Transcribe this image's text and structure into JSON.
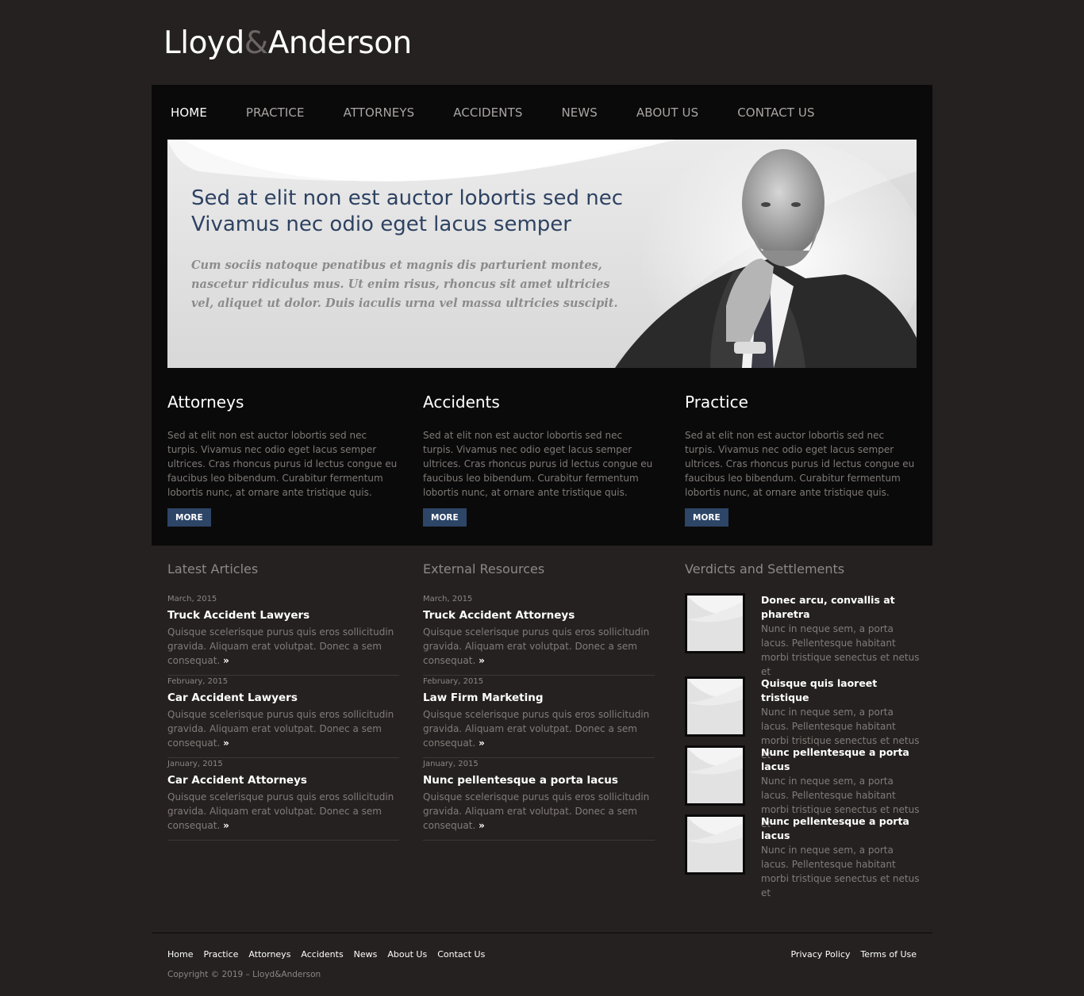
{
  "brand": {
    "name_part1": "Lloyd",
    "ampersand": "&",
    "name_part2": "Anderson"
  },
  "nav": {
    "items": [
      {
        "label": "HOME",
        "active": true
      },
      {
        "label": "PRACTICE"
      },
      {
        "label": "ATTORNEYS"
      },
      {
        "label": "ACCIDENTS"
      },
      {
        "label": "NEWS"
      },
      {
        "label": "ABOUT US"
      },
      {
        "label": "CONTACT US"
      }
    ]
  },
  "hero": {
    "title_line1": "Sed at elit non est auctor lobortis sed nec",
    "title_line2": "Vivamus nec odio eget lacus semper",
    "text": "Cum sociis natoque penatibus et magnis dis parturient montes, nascetur ridiculus mus. Ut enim risus, rhoncus sit amet ultricies vel, aliquet ut dolor. Duis iaculis urna vel massa ultricies suscipit."
  },
  "features": [
    {
      "title": "Attorneys",
      "text": "Sed at elit non est auctor lobortis sed nec turpis. Vivamus nec odio eget lacus semper ultrices. Cras rhoncus purus id lectus congue eu faucibus leo bibendum. Curabitur fermentum lobortis nunc, at ornare ante tristique quis.",
      "button": "MORE"
    },
    {
      "title": "Accidents",
      "text": "Sed at elit non est auctor lobortis sed nec turpis. Vivamus nec odio eget lacus semper ultrices. Cras rhoncus purus id lectus congue eu faucibus leo bibendum. Curabitur fermentum lobortis nunc, at ornare ante tristique quis.",
      "button": "MORE"
    },
    {
      "title": "Practice",
      "text": "Sed at elit non est auctor lobortis sed nec turpis. Vivamus nec odio eget lacus semper ultrices. Cras rhoncus purus id lectus congue eu faucibus leo bibendum. Curabitur fermentum lobortis nunc, at ornare ante tristique quis.",
      "button": "MORE"
    }
  ],
  "latest_articles": {
    "heading": "Latest Articles",
    "items": [
      {
        "date": "March, 2015",
        "title": "Truck Accident Lawyers",
        "body": "Quisque scelerisque purus quis eros sollicitudin gravida. Aliquam erat volutpat. Donec a sem consequat.",
        "arrow": "»"
      },
      {
        "date": "February, 2015",
        "title": "Car Accident Lawyers",
        "body": "Quisque scelerisque purus quis eros sollicitudin gravida. Aliquam erat volutpat. Donec a sem consequat.",
        "arrow": "»"
      },
      {
        "date": "January, 2015",
        "title": "Car Accident Attorneys",
        "body": "Quisque scelerisque purus quis eros sollicitudin gravida. Aliquam erat volutpat. Donec a sem consequat.",
        "arrow": "»"
      }
    ]
  },
  "external_resources": {
    "heading": "External Resources",
    "items": [
      {
        "date": "March, 2015",
        "title": "Truck Accident Attorneys",
        "body": "Quisque scelerisque purus quis eros sollicitudin gravida. Aliquam erat volutpat. Donec a sem consequat.",
        "arrow": "»"
      },
      {
        "date": "February, 2015",
        "title": "Law Firm Marketing",
        "body": "Quisque scelerisque purus quis eros sollicitudin gravida. Aliquam erat volutpat. Donec a sem consequat.",
        "arrow": "»"
      },
      {
        "date": "January, 2015",
        "title": "Nunc pellentesque a porta lacus",
        "body": "Quisque scelerisque purus quis eros sollicitudin gravida. Aliquam erat volutpat. Donec a sem consequat.",
        "arrow": "»"
      }
    ]
  },
  "verdicts": {
    "heading": "Verdicts and Settlements",
    "items": [
      {
        "title": "Donec arcu, convallis at pharetra",
        "body": "Nunc in neque sem, a porta lacus. Pellentesque habitant morbi tristique senectus et netus et"
      },
      {
        "title": "Quisque quis laoreet tristique",
        "body": "Nunc in neque sem, a porta lacus. Pellentesque habitant morbi tristique senectus et netus et"
      },
      {
        "title": "Nunc pellentesque a porta lacus",
        "body": "Nunc in neque sem, a porta lacus. Pellentesque habitant morbi tristique senectus et netus et"
      },
      {
        "title": "Nunc pellentesque a porta lacus",
        "body": "Nunc in neque sem, a porta lacus. Pellentesque habitant morbi tristique senectus et netus et"
      }
    ]
  },
  "footer": {
    "links": [
      "Home",
      "Practice",
      "Attorneys",
      "Accidents",
      "News",
      "About Us",
      "Contact Us"
    ],
    "legal": [
      "Privacy Policy",
      "Terms of Use"
    ],
    "copyright": "Copyright © 2019 – Lloyd&Anderson"
  },
  "colors": {
    "page_bg": "#252120",
    "panel_bg": "#0b0a0a",
    "accent_button": "#2d4566",
    "hero_title": "#2e4262"
  }
}
